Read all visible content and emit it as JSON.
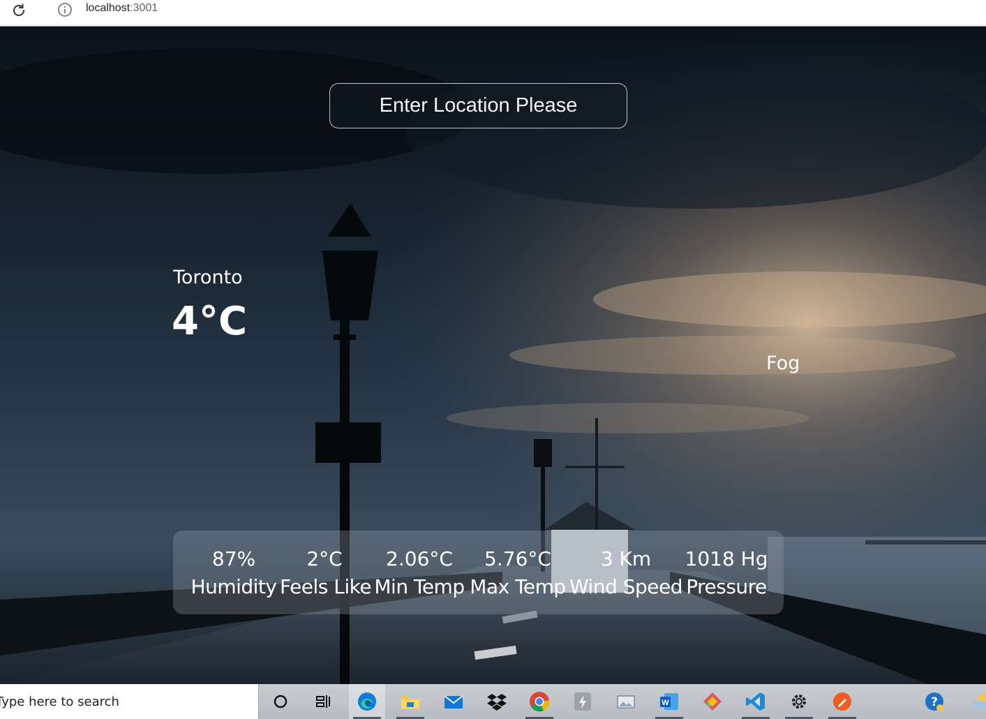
{
  "browser": {
    "url_host": "localhost",
    "url_port": ":3001"
  },
  "search": {
    "placeholder": "Enter Location Please"
  },
  "weather": {
    "city": "Toronto",
    "temperature": "4°C",
    "condition": "Fog"
  },
  "stats": [
    {
      "value": "87%",
      "label": "Humidity"
    },
    {
      "value": "2°C",
      "label": "Feels Like"
    },
    {
      "value": "2.06°C",
      "label": "Min Temp"
    },
    {
      "value": "5.76°C",
      "label": "Max Temp"
    },
    {
      "value": "3 Km",
      "label": "Wind Speed"
    },
    {
      "value": "1018 Hg",
      "label": "Pressure"
    }
  ],
  "taskbar": {
    "search_placeholder": "Type here to search",
    "apps": [
      "cortana-icon",
      "task-view-icon",
      "edge-icon",
      "file-explorer-icon",
      "mail-icon",
      "dropbox-icon",
      "chrome-icon",
      "app-bolt-icon",
      "photos-icon",
      "word-icon",
      "git-icon",
      "vscode-icon",
      "settings-icon",
      "postman-icon",
      "help-icon",
      "weather-tray-icon"
    ]
  },
  "colors": {
    "text": "#ffffff",
    "panel": "rgba(150,160,170,0.32)"
  }
}
